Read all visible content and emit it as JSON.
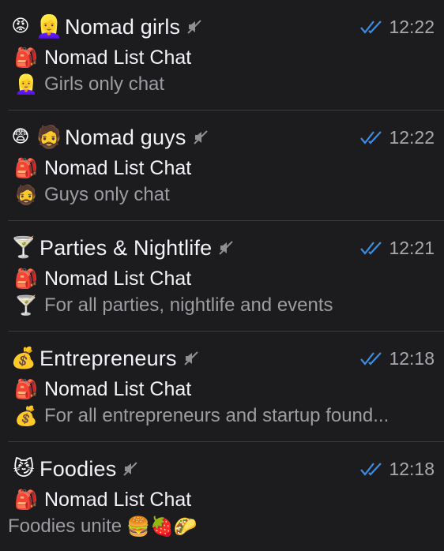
{
  "chats": [
    {
      "status_emoji": "😡",
      "avatar_emoji": "👱‍♀️",
      "title": "Nomad girls",
      "time": "12:22",
      "channel_emoji": "🎒",
      "channel": "Nomad List Chat",
      "preview_emoji": "👱‍♀️",
      "preview": "Girls only chat",
      "muted": true,
      "read": true
    },
    {
      "status_emoji": "😨",
      "avatar_emoji": "🧔",
      "title": "Nomad guys",
      "time": "12:22",
      "channel_emoji": "🎒",
      "channel": "Nomad List Chat",
      "preview_emoji": "🧔",
      "preview": "Guys only chat",
      "muted": true,
      "read": true
    },
    {
      "avatar_emoji": "🍸",
      "title": "Parties & Nightlife",
      "time": "12:21",
      "channel_emoji": "🎒",
      "channel": "Nomad List Chat",
      "preview_emoji": "🍸",
      "preview": "For all parties, nightlife and events",
      "muted": true,
      "read": true
    },
    {
      "avatar_emoji": "💰",
      "title": "Entrepreneurs",
      "time": "12:18",
      "channel_emoji": "🎒",
      "channel": "Nomad List Chat",
      "preview_emoji": "💰",
      "preview": "For all entrepreneurs and startup found...",
      "muted": true,
      "read": true
    },
    {
      "avatar_emoji": "😼",
      "title": "Foodies",
      "time": "12:18",
      "channel_emoji": "🎒",
      "channel": "Nomad List Chat",
      "preview": "Foodies unite",
      "preview_trailing_emojis": "🍔🍓🌮",
      "muted": true,
      "read": true
    }
  ],
  "colors": {
    "background": "#1c1c1e",
    "separator": "#3a3a3c",
    "title": "#f2f2f7",
    "preview": "#9c9ca1",
    "time": "#a8a8ad",
    "read_ticks": "#3a8ee6",
    "mute_icon": "#8e8e93"
  },
  "icons": {
    "mute": "speaker-muted-icon",
    "read": "double-check-icon"
  }
}
